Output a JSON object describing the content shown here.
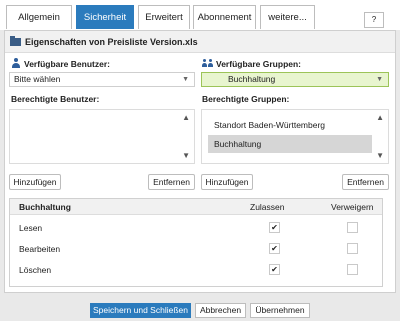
{
  "tabs": [
    {
      "label": "Allgemein",
      "active": false
    },
    {
      "label": "Sicherheit",
      "active": true
    },
    {
      "label": "Erweitert",
      "active": false
    },
    {
      "label": "Abonnement",
      "active": false
    },
    {
      "label": "weitere...",
      "active": false
    }
  ],
  "help_label": "?",
  "panel": {
    "title": "Eigenschaften von Preisliste Version.xls"
  },
  "users": {
    "available_label": "Verfügbare Benutzer:",
    "select_value": "Bitte wählen",
    "authorized_label": "Berechtigte Benutzer:",
    "items": [],
    "add_label": "Hinzufügen",
    "remove_label": "Entfernen"
  },
  "groups": {
    "available_label": "Verfügbare Gruppen:",
    "select_value": "Buchhaltung",
    "authorized_label": "Berechtigte Gruppen:",
    "items": [
      {
        "label": "Standort Baden-Württemberg",
        "selected": false
      },
      {
        "label": "Buchhaltung",
        "selected": true
      }
    ],
    "add_label": "Hinzufügen",
    "remove_label": "Entfernen"
  },
  "permissions": {
    "group_title": "Buchhaltung",
    "allow_label": "Zulassen",
    "deny_label": "Verweigern",
    "rows": [
      {
        "label": "Lesen",
        "allow": true,
        "deny": false
      },
      {
        "label": "Bearbeiten",
        "allow": true,
        "deny": false
      },
      {
        "label": "Löschen",
        "allow": true,
        "deny": false
      }
    ]
  },
  "footer": {
    "save_close_label": "Speichern und Schließen",
    "cancel_label": "Abbrechen",
    "apply_label": "Übernehmen"
  },
  "colors": {
    "accent": "#2b7bbd",
    "selected_group": "#e8f5cf"
  }
}
